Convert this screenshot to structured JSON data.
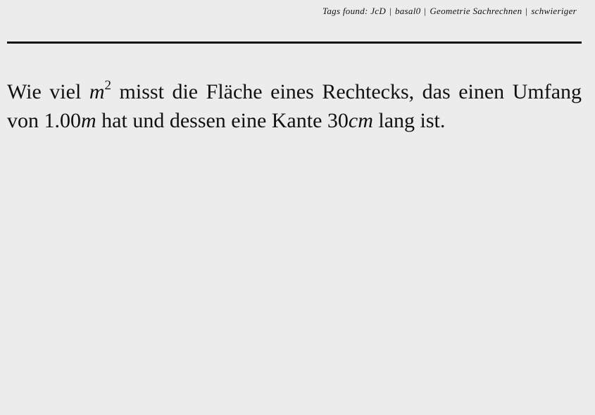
{
  "tags": {
    "prefix": "Tags found:",
    "items": [
      "JcD",
      "basal0",
      "Geometrie Sachrechnen",
      "schwieriger"
    ]
  },
  "question": {
    "part1": "Wie viel ",
    "unit_area_base": "m",
    "unit_area_exp": "2",
    "part2": " misst die Fläche eines Rechtecks, das einen Umfang von ",
    "perimeter_value": "1.00",
    "perimeter_unit": "m",
    "part3": " hat und dessen eine Kante ",
    "edge_value": "30",
    "edge_unit": "cm",
    "part4": " lang ist."
  }
}
